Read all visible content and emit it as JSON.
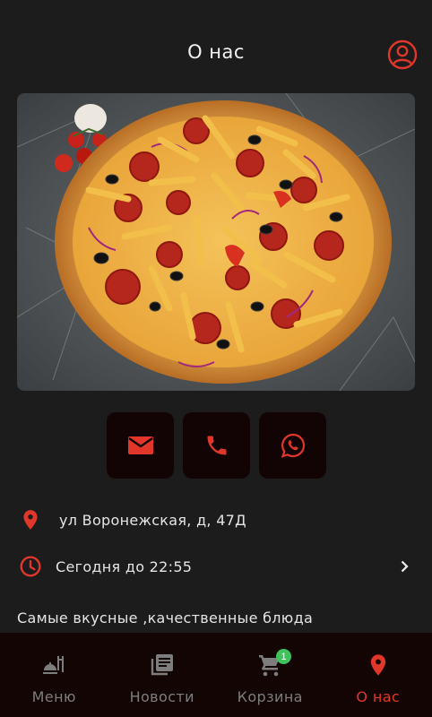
{
  "header": {
    "title": "О нас",
    "profile_icon": "account-circle-icon"
  },
  "colors": {
    "accent": "#e0372a",
    "background": "#1c1c1c",
    "nav_bg": "#140505",
    "badge": "#3ec25a",
    "inactive": "#7d7d7d"
  },
  "hero": {
    "image": "pizza-photo"
  },
  "contacts": [
    {
      "icon": "email-icon"
    },
    {
      "icon": "phone-icon"
    },
    {
      "icon": "whatsapp-icon"
    }
  ],
  "address": {
    "icon": "location-pin-icon",
    "text": "ул Воронежская, д, 47Д"
  },
  "hours": {
    "icon": "clock-icon",
    "text": "Сегодня до 22:55",
    "chevron": "chevron-right-icon"
  },
  "description": "Самые вкусные ,качественные блюда",
  "nav": [
    {
      "label": "Меню",
      "icon": "food-icon",
      "active": false
    },
    {
      "label": "Новости",
      "icon": "news-icon",
      "active": false
    },
    {
      "label": "Корзина",
      "icon": "cart-icon",
      "active": false,
      "badge": "1"
    },
    {
      "label": "О нас",
      "icon": "location-pin-icon",
      "active": true
    }
  ]
}
